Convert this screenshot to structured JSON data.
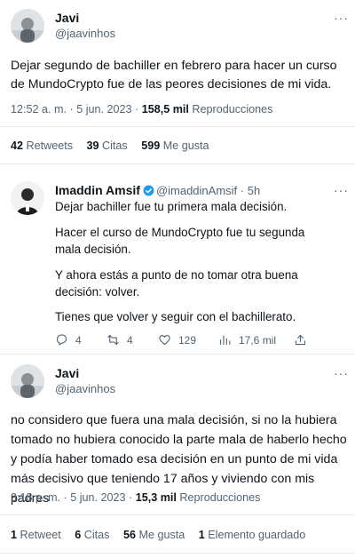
{
  "main_tweet": {
    "name": "Javi",
    "handle": "@jaavinhos",
    "more": "···",
    "text": "Dejar segundo de bachiller en febrero para hacer un curso de MundoCrypto fue de las peores decisiones de mi vida.",
    "time": "12:52 a. m. · 5 jun. 2023 · ",
    "views_count": "158,5 mil",
    "views_label": " Reproducciones",
    "retweets_count": "42",
    "retweets_label": " Retweets",
    "quotes_count": "39",
    "quotes_label": " Citas",
    "likes_count": "599",
    "likes_label": " Me gusta"
  },
  "reply_tweet": {
    "name": "Imaddin Amsif",
    "handle": "@imaddinAmsif · 5h",
    "more": "···",
    "paragraphs": [
      "Dejar bachiller fue tu primera mala decisión.",
      "Hacer el curso de MundoCrypto fue tu segunda mala decisión.",
      "Y ahora estás a punto de no tomar otra buena decisión: volver.",
      "Tienes que volver y seguir con el bachillerato."
    ],
    "actions": {
      "replies": "4",
      "retweets": "4",
      "likes": "129",
      "views": "17,6 mil"
    }
  },
  "second_tweet": {
    "name": "Javi",
    "handle": "@jaavinhos",
    "more": "···",
    "text": "no considero que fuera una mala decisión, si no la hubiera tomado no hubiera conocido la parte mala de haberlo hecho y podía haber tomado esa decisión en un punto de mi vida más decisivo que teniendo 17 años y viviendo con mis padres",
    "time": "3:18 p. m. · 5 jun. 2023 · ",
    "views_count": "15,3 mil",
    "views_label": " Reproducciones",
    "retweets_count": "1",
    "retweets_label": " Retweet",
    "quotes_count": "6",
    "quotes_label": " Citas",
    "likes_count": "56",
    "likes_label": " Me gusta",
    "bookmarks_count": "1",
    "bookmarks_label": " Elemento guardado"
  },
  "colors": {
    "text": "#0f1419",
    "secondary": "#536471",
    "divider": "#e6e9eb",
    "verified": "#1d9bf0"
  }
}
